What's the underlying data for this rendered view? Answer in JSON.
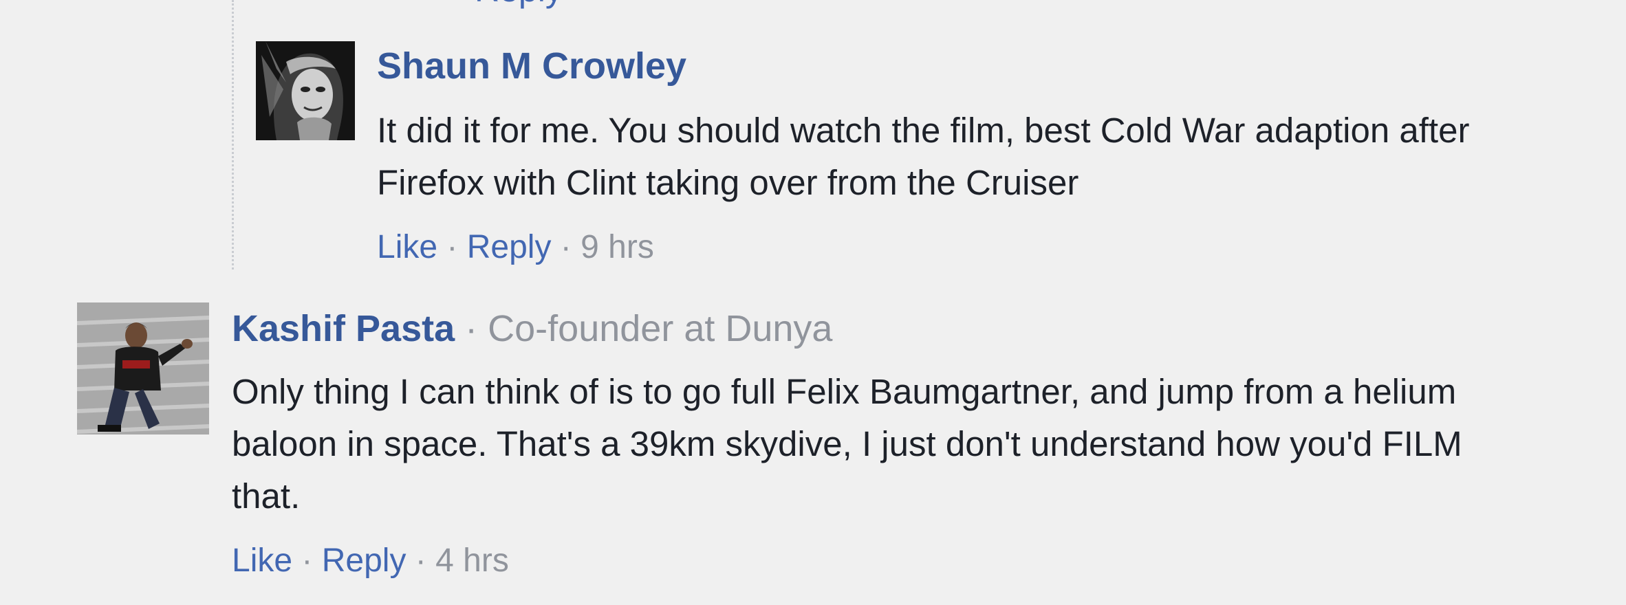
{
  "comments": [
    {
      "author": "Shaun M Crowley",
      "subtitle": "",
      "text": "It did it for me. You should watch the film, best Cold War adaption after Firefox with Clint taking over from the Cruiser",
      "like_label": "Like",
      "reply_label": "Reply",
      "separator": "·",
      "time": "9 hrs"
    },
    {
      "author": "Kashif Pasta",
      "subtitle": "Co-founder at Dunya",
      "separator": "·",
      "text": "Only thing I can think of is to go full Felix Baumgartner, and jump from a helium baloon in space. That's a 39km skydive, I just don't understand how you'd FILM that.",
      "like_label": "Like",
      "reply_label": "Reply",
      "time": "4 hrs"
    }
  ],
  "above_cutoff": {
    "partial_link": "Reply"
  },
  "colors": {
    "background": "#f0f0f0",
    "author": "#365899",
    "link": "#4267b2",
    "muted": "#90949c",
    "text": "#1d2129"
  }
}
